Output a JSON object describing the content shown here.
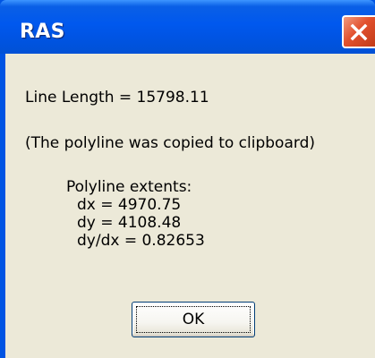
{
  "window": {
    "title": "RAS",
    "close_icon": "close-icon"
  },
  "message": {
    "line_length": "Line Length = 15798.11",
    "clipboard_note": "(The polyline was copied to clipboard)",
    "extents_heading": "Polyline extents:",
    "dx": "dx = 4970.75",
    "dy": "dy = 4108.48",
    "ratio": "dy/dx = 0.82653"
  },
  "buttons": {
    "ok_label": "OK"
  },
  "colors": {
    "title_bar": "#0054e3",
    "dialog_bg": "#ece9d8",
    "close_button": "#e2512e"
  }
}
